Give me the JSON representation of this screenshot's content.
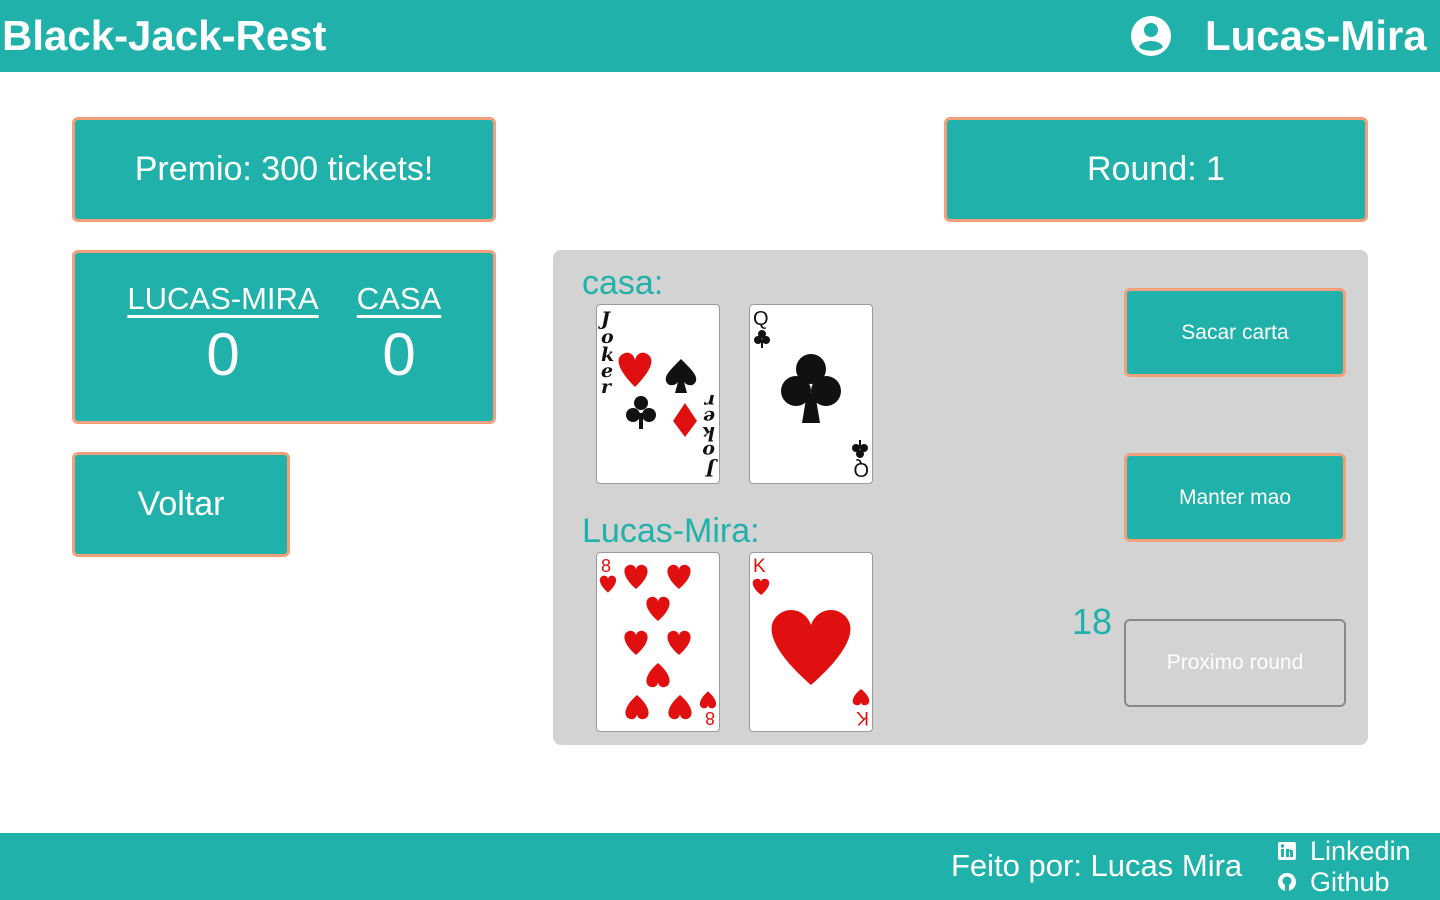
{
  "header": {
    "app_title": "Black-Jack-Rest",
    "user_icon": "user-circle-icon",
    "username": "Lucas-Mira"
  },
  "prize": {
    "text": "Premio: 300 tickets!"
  },
  "round": {
    "text": "Round: 1"
  },
  "scoreboard": {
    "player_label": "LUCAS-MIRA",
    "player_score": "0",
    "house_label": "CASA",
    "house_score": "0"
  },
  "back_button": {
    "label": "Voltar"
  },
  "table": {
    "house_label": "casa:",
    "house_cards": [
      {
        "rank": "Joker",
        "suit": "joker"
      },
      {
        "rank": "Q",
        "suit": "clubs"
      }
    ],
    "player_label": "Lucas-Mira:",
    "player_cards": [
      {
        "rank": "8",
        "suit": "hearts"
      },
      {
        "rank": "K",
        "suit": "hearts"
      }
    ],
    "player_points": "18"
  },
  "actions": {
    "draw_card": "Sacar carta",
    "keep_hand": "Manter mao",
    "next_round": "Proximo round"
  },
  "footer": {
    "made_by": "Feito por: Lucas Mira",
    "linkedin_label": "Linkedin",
    "linkedin_icon": "linkedin-icon",
    "github_label": "Github",
    "github_icon": "github-icon"
  },
  "colors": {
    "primary": "#20b2aa",
    "border_accent": "#f2a07b",
    "table_bg": "#d3d3d3",
    "card_red": "#e01010",
    "card_black": "#111111"
  }
}
